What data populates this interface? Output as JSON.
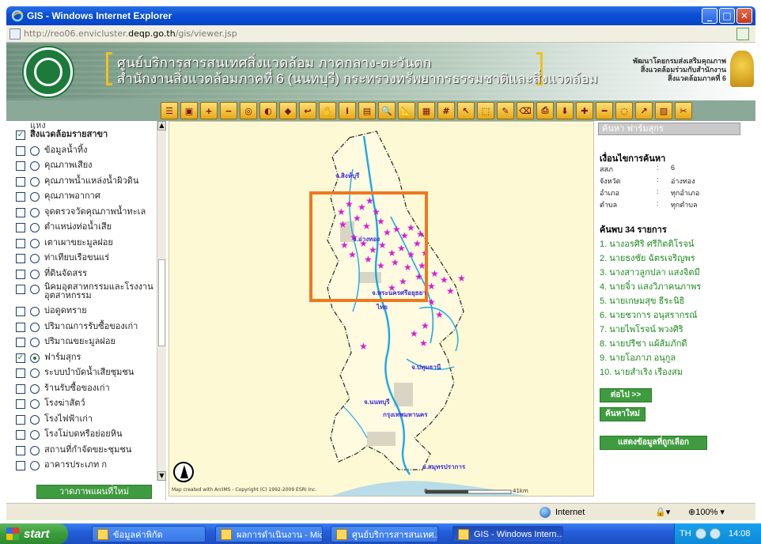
{
  "window": {
    "title": "GIS - Windows Internet Explorer",
    "url_prefix": "http://reo06.envicluster.",
    "url_domain": "deqp.go.th",
    "url_suffix": "/gis/viewer.jsp"
  },
  "banner": {
    "line1": "ศูนย์บริการสารสนเทศสิ่งแวดล้อม ภาคกลาง-ตะวันตก",
    "line2": "สำนักงานสิ่งแวดล้อมภาคที่ 6 (นนทบุรี) กระทรวงทรัพยากรธรรมชาติและสิ่งแวดล้อม",
    "right_line1": "พัฒนาโดยกรมส่งเสริมคุณภาพ",
    "right_line2": "สิ่งแวดล้อมร่วมกับสำนักงาน",
    "right_line3": "สิ่งแวดล้อมภาคที่ 6"
  },
  "toolbar": {
    "tools": [
      "list-icon",
      "legend-icon",
      "zoom-in-icon",
      "zoom-out-icon",
      "zoom-full-icon",
      "zoom-layer-icon",
      "zoom-active-icon",
      "back-icon",
      "pan-icon",
      "identify-icon",
      "hyperlink-icon",
      "find-icon",
      "measure-icon",
      "attribute-table-icon",
      "grid-icon",
      "select-icon",
      "select-shape-icon",
      "erase-icon",
      "clear-icon",
      "print-icon",
      "export-icon",
      "add-point-icon",
      "add-line-icon",
      "buffer-icon",
      "route-icon",
      "overlay-icon",
      "tool-icon"
    ]
  },
  "layers": {
    "top_label": "แหง",
    "items": [
      {
        "label": "สิ่งแวดล้อมรายสาขา",
        "checked": true,
        "radio": false,
        "bold": true
      },
      {
        "label": "ข้อมูลน้ำทิ้ง",
        "checked": false,
        "radio": true,
        "selected": false
      },
      {
        "label": "คุณภาพเสียง",
        "checked": false,
        "radio": true,
        "selected": false
      },
      {
        "label": "คุณภาพน้ำแหล่งน้ำผิวดิน",
        "checked": false,
        "radio": true,
        "selected": false
      },
      {
        "label": "คุณภาพอากาศ",
        "checked": false,
        "radio": true,
        "selected": false
      },
      {
        "label": "จุดตรวจวัดคุณภาพน้ำทะเล",
        "checked": false,
        "radio": true,
        "selected": false
      },
      {
        "label": "ตำแหน่งท่อน้ำเสีย",
        "checked": false,
        "radio": true,
        "selected": false
      },
      {
        "label": "เตาเผาขยะมูลฝอย",
        "checked": false,
        "radio": true,
        "selected": false
      },
      {
        "label": "ท่าเทียบเรือขนแร่",
        "checked": false,
        "radio": true,
        "selected": false
      },
      {
        "label": "ที่ดินจัดสรร",
        "checked": false,
        "radio": true,
        "selected": false
      },
      {
        "label": "นิคมอุตสาหกรรมและโรงงานอุตสาหกรรม",
        "checked": false,
        "radio": true,
        "selected": false
      },
      {
        "label": "บ่อดูดทราย",
        "checked": false,
        "radio": true,
        "selected": false
      },
      {
        "label": "ปริมาณการรับซื้อของเก่า",
        "checked": false,
        "radio": true,
        "selected": false
      },
      {
        "label": "ปริมาณขยะมูลฝอย",
        "checked": false,
        "radio": true,
        "selected": false
      },
      {
        "label": "ฟาร์มสุกร",
        "checked": true,
        "radio": true,
        "selected": true
      },
      {
        "label": "ระบบบำบัดน้ำเสียชุมชน",
        "checked": false,
        "radio": true,
        "selected": false
      },
      {
        "label": "ร้านรับซื้อของเก่า",
        "checked": false,
        "radio": true,
        "selected": false
      },
      {
        "label": "โรงฆ่าสัตว์",
        "checked": false,
        "radio": true,
        "selected": false
      },
      {
        "label": "โรงไฟฟ้าเก่า",
        "checked": false,
        "radio": true,
        "selected": false
      },
      {
        "label": "โรงโม่บดหรือย่อยหิน",
        "checked": false,
        "radio": true,
        "selected": false
      },
      {
        "label": "สถานที่กำจัดขยะชุมชน",
        "checked": false,
        "radio": true,
        "selected": false
      },
      {
        "label": "อาคารประเภท ก",
        "checked": false,
        "radio": true,
        "selected": false
      }
    ],
    "redraw_label": "วาดภาพแผนที่ใหม่"
  },
  "map": {
    "copyright": "Map created with ArcIMS - Copyright (C) 1992-2009 ESRI Inc.",
    "scale_zero": "0",
    "scale_label": "41km",
    "places": [
      {
        "name": "จ.สิงห์บุรี"
      },
      {
        "name": "จ.อ่างทอง"
      },
      {
        "name": "จ.พระนครศรีอยุธยา"
      },
      {
        "name": "ไทย"
      },
      {
        "name": "จ.ปทุมธานี"
      },
      {
        "name": "จ.นนทบุรี"
      },
      {
        "name": "กรุงเทพมหานคร"
      },
      {
        "name": "จ.สมุทรปราการ"
      }
    ],
    "marker_color": "#d21fd2",
    "river_color": "#1aa8e8",
    "highlight_color": "#f07820"
  },
  "search": {
    "title": "ค้นหา ฟาร์มสุกร",
    "condition_title": "เงื่อนไขการค้นหา",
    "conditions": [
      {
        "key": "สสภ",
        "colon": ":",
        "value": "6"
      },
      {
        "key": "จังหวัด",
        "colon": ":",
        "value": "อ่างทอง"
      },
      {
        "key": "อำเภอ",
        "colon": ":",
        "value": "ทุกอำเภอ"
      },
      {
        "key": "ตำบล",
        "colon": ":",
        "value": "ทุกตำบล"
      }
    ],
    "found_title": "ค้นพบ 34 รายการ",
    "results": [
      "1. นางอรศิริ ศรีกิตติโรจน์",
      "2. นายธงชัย ฉัตรเจริญพร",
      "3. นางสาวลูกปลา แสงจิตมี",
      "4. นายจิ๋ว แสงวิภาคนภาพร",
      "5. นายเกษมสุข ธีระนิธิ",
      "6. นายชวการ อนุสรากรณ์",
      "7. นายไพโรจน์ พวงศิริ",
      "8. นายปรีชา แผ้ส้มภักดี",
      "9. นายโอภาภ อนุกูล",
      "10. นายสำเริง เรืองสม"
    ],
    "next_label": "ต่อไป >>",
    "new_search_label": "ค้นหาใหม่",
    "show_selected_label": "แสดงข้อมูลที่ถูกเลือก"
  },
  "status": {
    "zone": "Internet",
    "zoom": "100%"
  },
  "taskbar": {
    "start_label": "start",
    "tasks": [
      {
        "label": "ข้อมูลค่าพิกัด",
        "active": false
      },
      {
        "label": "ผลการดำเนินงาน - Mic...",
        "active": false
      },
      {
        "label": "ศูนย์บริการสารสนเทศ...",
        "active": false
      },
      {
        "label": "GIS - Windows Intern...",
        "active": true
      }
    ],
    "lang": "TH",
    "clock": "14:08"
  }
}
